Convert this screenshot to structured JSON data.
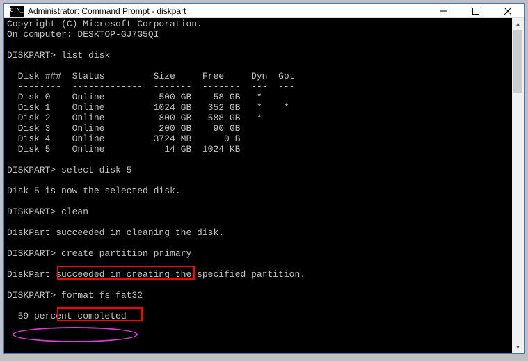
{
  "window": {
    "icon_text": "C:\\_",
    "title": "Administrator: Command Prompt - diskpart"
  },
  "terminal": {
    "lines": {
      "copyright": "Copyright (C) Microsoft Corporation.",
      "computer": "On computer: DESKTOP-GJ7G5QI",
      "blank": "",
      "prompt_list": "DISKPART> list disk",
      "hdr": "  Disk ###  Status         Size     Free     Dyn  Gpt",
      "sep": "  --------  -------------  -------  -------  ---  ---",
      "d0": "  Disk 0    Online          500 GB    58 GB   *",
      "d1": "  Disk 1    Online         1024 GB   352 GB   *    *",
      "d2": "  Disk 2    Online          800 GB   588 GB   *",
      "d3": "  Disk 3    Online          200 GB    90 GB",
      "d4": "  Disk 4    Online         3724 MB      0 B",
      "d5": "  Disk 5    Online           14 GB  1024 KB",
      "prompt_select": "DISKPART> select disk 5",
      "selected": "Disk 5 is now the selected disk.",
      "prompt_clean": "DISKPART> clean",
      "clean_ok": "DiskPart succeeded in cleaning the disk.",
      "prompt_create": "DISKPART> create partition primary",
      "create_ok": "DiskPart succeeded in creating the specified partition.",
      "prompt_format": "DISKPART> format fs=fat32",
      "progress": "  59 percent completed"
    }
  },
  "highlights": {
    "red1_target": "create partition primary",
    "red2_target": "format fs=fat32",
    "ellipse_target": "59 percent completed"
  }
}
